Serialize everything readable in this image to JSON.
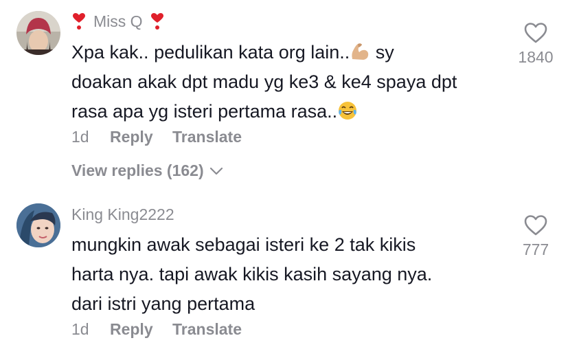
{
  "comments": [
    {
      "username": "Miss Q",
      "lines": [
        "Xpa kak.. pedulikan kata org lain..",
        " sy",
        "doakan akak dpt madu yg ke3 & ke4 spaya dpt",
        "rasa apa yg isteri pertama rasa.."
      ],
      "time": "1d",
      "reply_label": "Reply",
      "translate_label": "Translate",
      "view_replies": "View replies (162)",
      "likes": "1840"
    },
    {
      "username": "King King2222",
      "lines": [
        "mungkin awak sebagai isteri ke 2 tak kikis",
        "harta nya. tapi awak kikis kasih sayang nya.",
        "dari istri yang pertama"
      ],
      "time": "1d",
      "reply_label": "Reply",
      "translate_label": "Translate",
      "likes": "777"
    }
  ],
  "colors": {
    "text": "#161823",
    "muted": "#8a8b91",
    "heart_emoji": "#e0202b"
  },
  "icons": {
    "like": "heart-outline-icon",
    "expand": "chevron-down-icon",
    "username_decoration": "heart-exclamation-emoji",
    "flex": "flexed-biceps-emoji",
    "laugh": "tears-of-joy-emoji"
  }
}
